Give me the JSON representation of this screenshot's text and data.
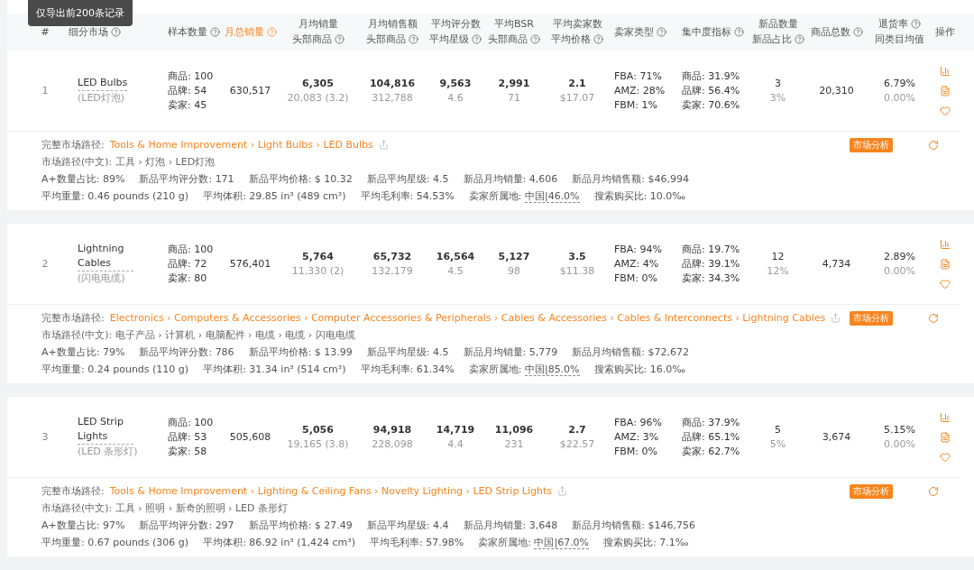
{
  "tooltip": "仅导出前200条记录",
  "columns": [
    {
      "active": false,
      "lines": [
        {
          "text": "#",
          "help": false
        }
      ]
    },
    {
      "active": false,
      "lines": [
        {
          "text": "细分市场",
          "help": true
        }
      ]
    },
    {
      "active": false,
      "lines": [
        {
          "text": "样本数量",
          "help": true
        }
      ]
    },
    {
      "active": true,
      "lines": [
        {
          "text": "月总销量",
          "help": true
        }
      ]
    },
    {
      "active": false,
      "lines": [
        {
          "text": "月均销量",
          "help": false
        },
        {
          "text": "头部商品",
          "help": true
        }
      ]
    },
    {
      "active": false,
      "lines": [
        {
          "text": "月均销售额",
          "help": false
        },
        {
          "text": "头部商品",
          "help": true
        }
      ]
    },
    {
      "active": false,
      "lines": [
        {
          "text": "平均评分数",
          "help": false
        },
        {
          "text": "平均星级",
          "help": true
        }
      ]
    },
    {
      "active": false,
      "lines": [
        {
          "text": "平均BSR",
          "help": false
        },
        {
          "text": "头部商品",
          "help": true
        }
      ]
    },
    {
      "active": false,
      "lines": [
        {
          "text": "平均卖家数",
          "help": false
        },
        {
          "text": "平均价格",
          "help": true
        }
      ]
    },
    {
      "active": false,
      "lines": [
        {
          "text": "卖家类型",
          "help": true
        }
      ]
    },
    {
      "active": false,
      "lines": [
        {
          "text": "集中度指标",
          "help": true
        }
      ]
    },
    {
      "active": false,
      "lines": [
        {
          "text": "新品数量",
          "help": false
        },
        {
          "text": "新品占比",
          "help": true
        }
      ]
    },
    {
      "active": false,
      "lines": [
        {
          "text": "商品总数",
          "help": true
        }
      ]
    },
    {
      "active": false,
      "lines": [
        {
          "text": "退货率",
          "help": true
        },
        {
          "text": "同类目均值",
          "help": false
        }
      ]
    },
    {
      "active": false,
      "lines": [
        {
          "text": "操作",
          "help": false
        }
      ]
    }
  ],
  "rows": [
    {
      "index": "1",
      "name": "LED Bulbs",
      "name_cn": "(LED灯泡)",
      "sample": [
        "商品: 100",
        "品牌: 54",
        "卖家: 45"
      ],
      "total": "630,517",
      "sales": [
        "6,305",
        "20,083 (3.2)"
      ],
      "revenue": [
        "104,816",
        "312,788"
      ],
      "rating": [
        "9,563",
        "4.6"
      ],
      "bsr": [
        "2,991",
        "71"
      ],
      "sellers": [
        "2.1",
        "$17.07"
      ],
      "types": [
        "FBA: 71%",
        "AMZ: 28%",
        "FBM: 1%"
      ],
      "concentration": [
        "商品: 31.9%",
        "品牌: 56.4%",
        "卖家: 70.6%"
      ],
      "new": [
        "3",
        "3%"
      ],
      "products": "20,310",
      "returns": [
        "6.79%",
        "0.00%"
      ],
      "path_label": "完整市场路径:",
      "path": "Tools & Home Improvement › Light Bulbs › LED Bulbs",
      "analysis": "市场分析",
      "path_cn": "市场路径(中文): 工具 › 灯泡 › LED灯泡",
      "stats": [
        [
          {
            "label": "A+数量占比:",
            "value": "89%"
          },
          {
            "label": "新品平均评分数:",
            "value": "171"
          },
          {
            "label": "新品平均价格:",
            "value": "$ 10.32"
          },
          {
            "label": "新品平均星级:",
            "value": "4.5"
          },
          {
            "label": "新品月均销量:",
            "value": "4,606"
          },
          {
            "label": "新品月均销售额:",
            "value": "$46,994"
          }
        ],
        [
          {
            "label": "平均重量:",
            "value": "0.46 pounds (210 g)"
          },
          {
            "label": "平均体积:",
            "value": "29.85 in³ (489 cm³)"
          },
          {
            "label": "平均毛利率:",
            "value": "54.53%"
          },
          {
            "label": "卖家所属地:",
            "value": "中国|46.0%",
            "underline": true
          },
          {
            "label": "搜索购买比:",
            "value": "10.0‰"
          }
        ]
      ]
    },
    {
      "index": "2",
      "name": "Lightning Cables",
      "name_cn": "(闪电电缆)",
      "sample": [
        "商品: 100",
        "品牌: 72",
        "卖家: 80"
      ],
      "total": "576,401",
      "sales": [
        "5,764",
        "11,330 (2)"
      ],
      "revenue": [
        "65,732",
        "132,179"
      ],
      "rating": [
        "16,564",
        "4.5"
      ],
      "bsr": [
        "5,127",
        "98"
      ],
      "sellers": [
        "3.5",
        "$11.38"
      ],
      "types": [
        "FBA: 94%",
        "AMZ: 4%",
        "FBM: 0%"
      ],
      "concentration": [
        "商品: 19.7%",
        "品牌: 39.1%",
        "卖家: 34.3%"
      ],
      "new": [
        "12",
        "12%"
      ],
      "products": "4,734",
      "returns": [
        "2.89%",
        "0.00%"
      ],
      "path_label": "完整市场路径:",
      "path": "Electronics › Computers & Accessories › Computer Accessories & Peripherals › Cables & Accessories › Cables & Interconnects › Lightning Cables",
      "analysis": "市场分析",
      "path_cn": "市场路径(中文): 电子产品 › 计算机 › 电脑配件 › 电缆 › 电缆 › 闪电电缆",
      "stats": [
        [
          {
            "label": "A+数量占比:",
            "value": "79%"
          },
          {
            "label": "新品平均评分数:",
            "value": "786"
          },
          {
            "label": "新品平均价格:",
            "value": "$ 13.99"
          },
          {
            "label": "新品平均星级:",
            "value": "4.5"
          },
          {
            "label": "新品月均销量:",
            "value": "5,779"
          },
          {
            "label": "新品月均销售额:",
            "value": "$72,672"
          }
        ],
        [
          {
            "label": "平均重量:",
            "value": "0.24 pounds (110 g)"
          },
          {
            "label": "平均体积:",
            "value": "31.34 in³ (514 cm³)"
          },
          {
            "label": "平均毛利率:",
            "value": "61.34%"
          },
          {
            "label": "卖家所属地:",
            "value": "中国|85.0%",
            "underline": true
          },
          {
            "label": "搜索购买比:",
            "value": "16.0‰"
          }
        ]
      ]
    },
    {
      "index": "3",
      "name": "LED Strip Lights",
      "name_cn": "(LED 条形灯)",
      "sample": [
        "商品: 100",
        "品牌: 53",
        "卖家: 58"
      ],
      "total": "505,608",
      "sales": [
        "5,056",
        "19,165 (3.8)"
      ],
      "revenue": [
        "94,918",
        "228,098"
      ],
      "rating": [
        "14,719",
        "4.4"
      ],
      "bsr": [
        "11,096",
        "231"
      ],
      "sellers": [
        "2.7",
        "$22.57"
      ],
      "types": [
        "FBA: 96%",
        "AMZ: 3%",
        "FBM: 0%"
      ],
      "concentration": [
        "商品: 37.9%",
        "品牌: 65.1%",
        "卖家: 62.7%"
      ],
      "new": [
        "5",
        "5%"
      ],
      "products": "3,674",
      "returns": [
        "5.15%",
        "0.00%"
      ],
      "path_label": "完整市场路径:",
      "path": "Tools & Home Improvement › Lighting & Ceiling Fans › Novelty Lighting › LED Strip Lights",
      "analysis": "市场分析",
      "path_cn": "市场路径(中文): 工具 › 照明 › 新奇的照明 › LED 条形灯",
      "stats": [
        [
          {
            "label": "A+数量占比:",
            "value": "97%"
          },
          {
            "label": "新品平均评分数:",
            "value": "297"
          },
          {
            "label": "新品平均价格:",
            "value": "$ 27.49"
          },
          {
            "label": "新品平均星级:",
            "value": "4.4"
          },
          {
            "label": "新品月均销量:",
            "value": "3,648"
          },
          {
            "label": "新品月均销售额:",
            "value": "$146,756"
          }
        ],
        [
          {
            "label": "平均重量:",
            "value": "0.67 pounds (306 g)"
          },
          {
            "label": "平均体积:",
            "value": "86.92 in³ (1,424 cm³)"
          },
          {
            "label": "平均毛利率:",
            "value": "57.98%"
          },
          {
            "label": "卖家所属地:",
            "value": "中国|67.0%",
            "underline": true
          },
          {
            "label": "搜索购买比:",
            "value": "7.1‰"
          }
        ]
      ]
    }
  ]
}
